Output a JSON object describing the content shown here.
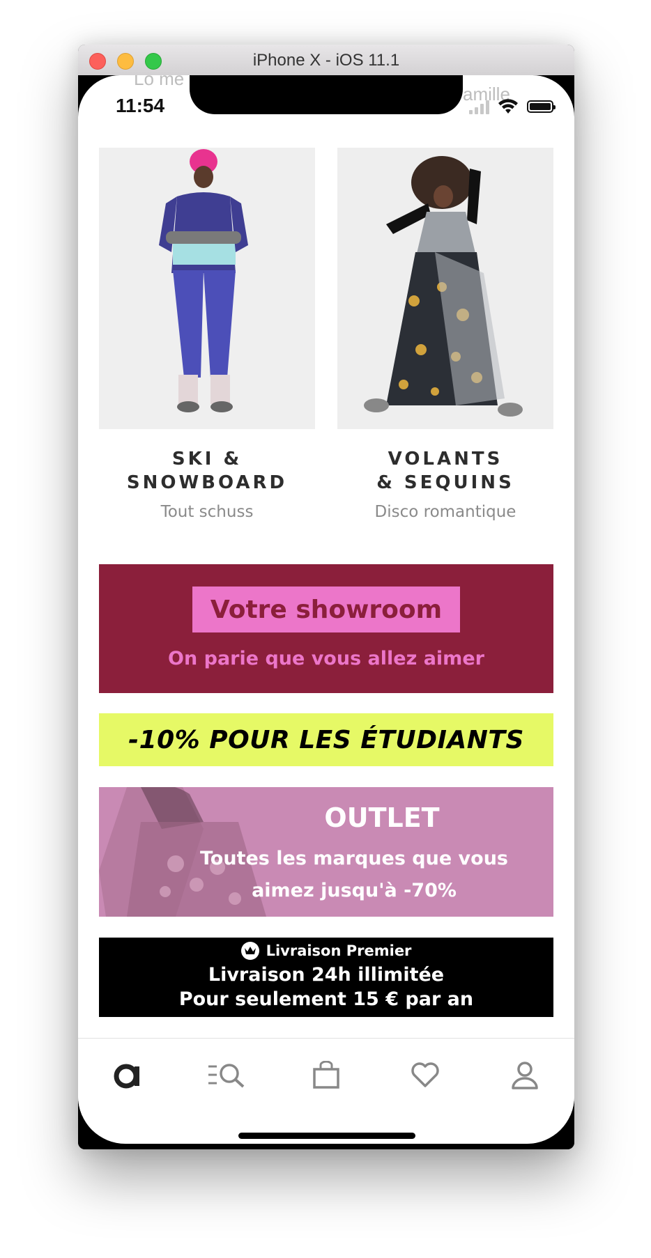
{
  "window": {
    "title": "iPhone X - iOS 11.1"
  },
  "status_bar": {
    "time": "11:54",
    "ghost_left": "Lo me",
    "ghost_right": "amille"
  },
  "tiles": [
    {
      "title_line1": "SKI &",
      "title_line2": "SNOWBOARD",
      "subtitle": "Tout schuss"
    },
    {
      "title_line1": "VOLANTS",
      "title_line2": "& SEQUINS",
      "subtitle": "Disco romantique"
    }
  ],
  "showroom": {
    "title": "Votre showroom",
    "subtitle": "On parie que vous allez aimer",
    "bg_color": "#8b1f3b",
    "accent_color": "#ec76c9"
  },
  "students": {
    "text": "-10% POUR LES ÉTUDIANTS",
    "bg_color": "#e6f966"
  },
  "outlet": {
    "title": "OUTLET",
    "line1": "Toutes les marques que vous",
    "line2": "aimez jusqu'à -70%",
    "bg_color": "#c98ab4"
  },
  "premier": {
    "label": "Livraison Premier",
    "line1": "Livraison 24h illimitée",
    "line2": "Pour seulement 15 € par an"
  },
  "tabbar": {
    "items": [
      "home-icon",
      "search-categories-icon",
      "bag-icon",
      "heart-icon",
      "account-icon"
    ]
  }
}
